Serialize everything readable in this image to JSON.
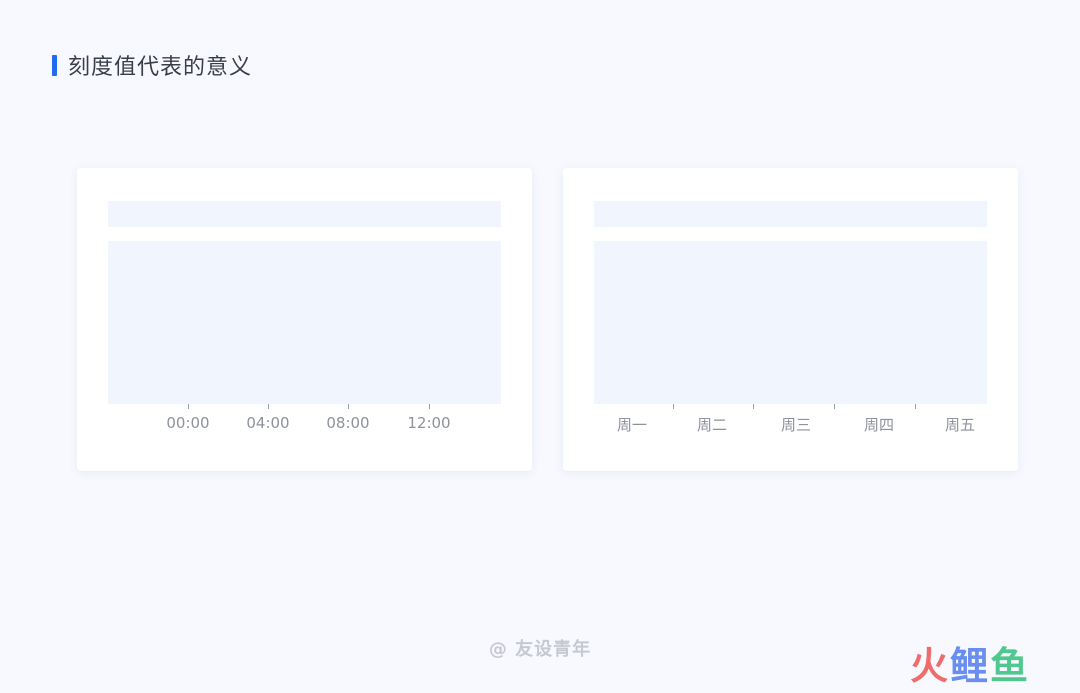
{
  "header": {
    "title": "刻度值代表的意义"
  },
  "card_left": {
    "labels": [
      "00:00",
      "04:00",
      "08:00",
      "12:00"
    ]
  },
  "card_right": {
    "labels": [
      "周一",
      "周二",
      "周三",
      "周四",
      "周五"
    ]
  },
  "footer": {
    "watermark": "@ 友设青年"
  },
  "logo": {
    "chars": [
      "火",
      "鲤",
      "鱼"
    ]
  },
  "colors": {
    "accent": "#1f6bf2",
    "logo_fire": "#f06b6b",
    "logo_carp": "#6a8ef0",
    "logo_fish": "#4fc78f"
  }
}
